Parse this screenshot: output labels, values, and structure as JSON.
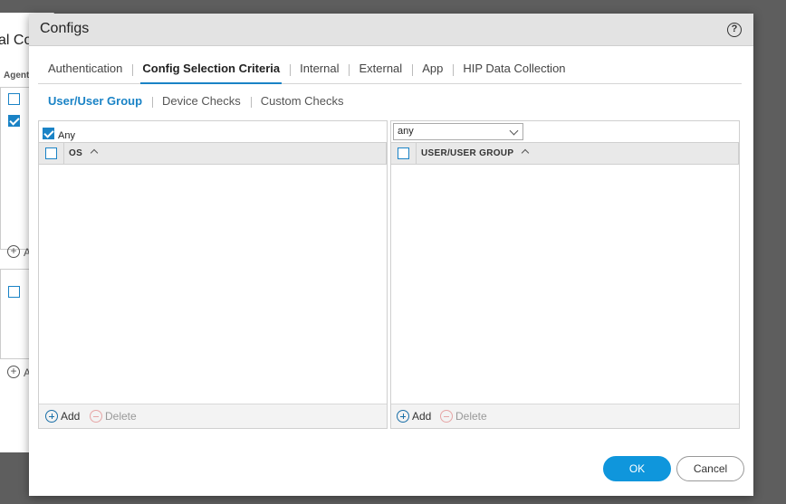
{
  "background": {
    "title_fragment": "al Co",
    "column_fragment": "Agent",
    "add_fragment": "A"
  },
  "dialog": {
    "title": "Configs",
    "help_glyph": "?",
    "help_icon": "question-circle-icon"
  },
  "tabs": [
    {
      "label": "Authentication",
      "active": false
    },
    {
      "label": "Config Selection Criteria",
      "active": true
    },
    {
      "label": "Internal",
      "active": false
    },
    {
      "label": "External",
      "active": false
    },
    {
      "label": "App",
      "active": false
    },
    {
      "label": "HIP Data Collection",
      "active": false
    }
  ],
  "subtabs": [
    {
      "label": "User/User Group",
      "active": true
    },
    {
      "label": "Device Checks",
      "active": false
    },
    {
      "label": "Custom Checks",
      "active": false
    }
  ],
  "left_pane": {
    "any_label": "Any",
    "any_checked": true,
    "column_header": "OS",
    "rows": [],
    "add_label": "Add",
    "delete_label": "Delete"
  },
  "right_pane": {
    "select_value": "any",
    "column_header": "USER/USER GROUP",
    "rows": [],
    "add_label": "Add",
    "delete_label": "Delete"
  },
  "buttons": {
    "ok": "OK",
    "cancel": "Cancel"
  },
  "colors": {
    "accent": "#1a83c6",
    "ok_button": "#0f96dc"
  }
}
